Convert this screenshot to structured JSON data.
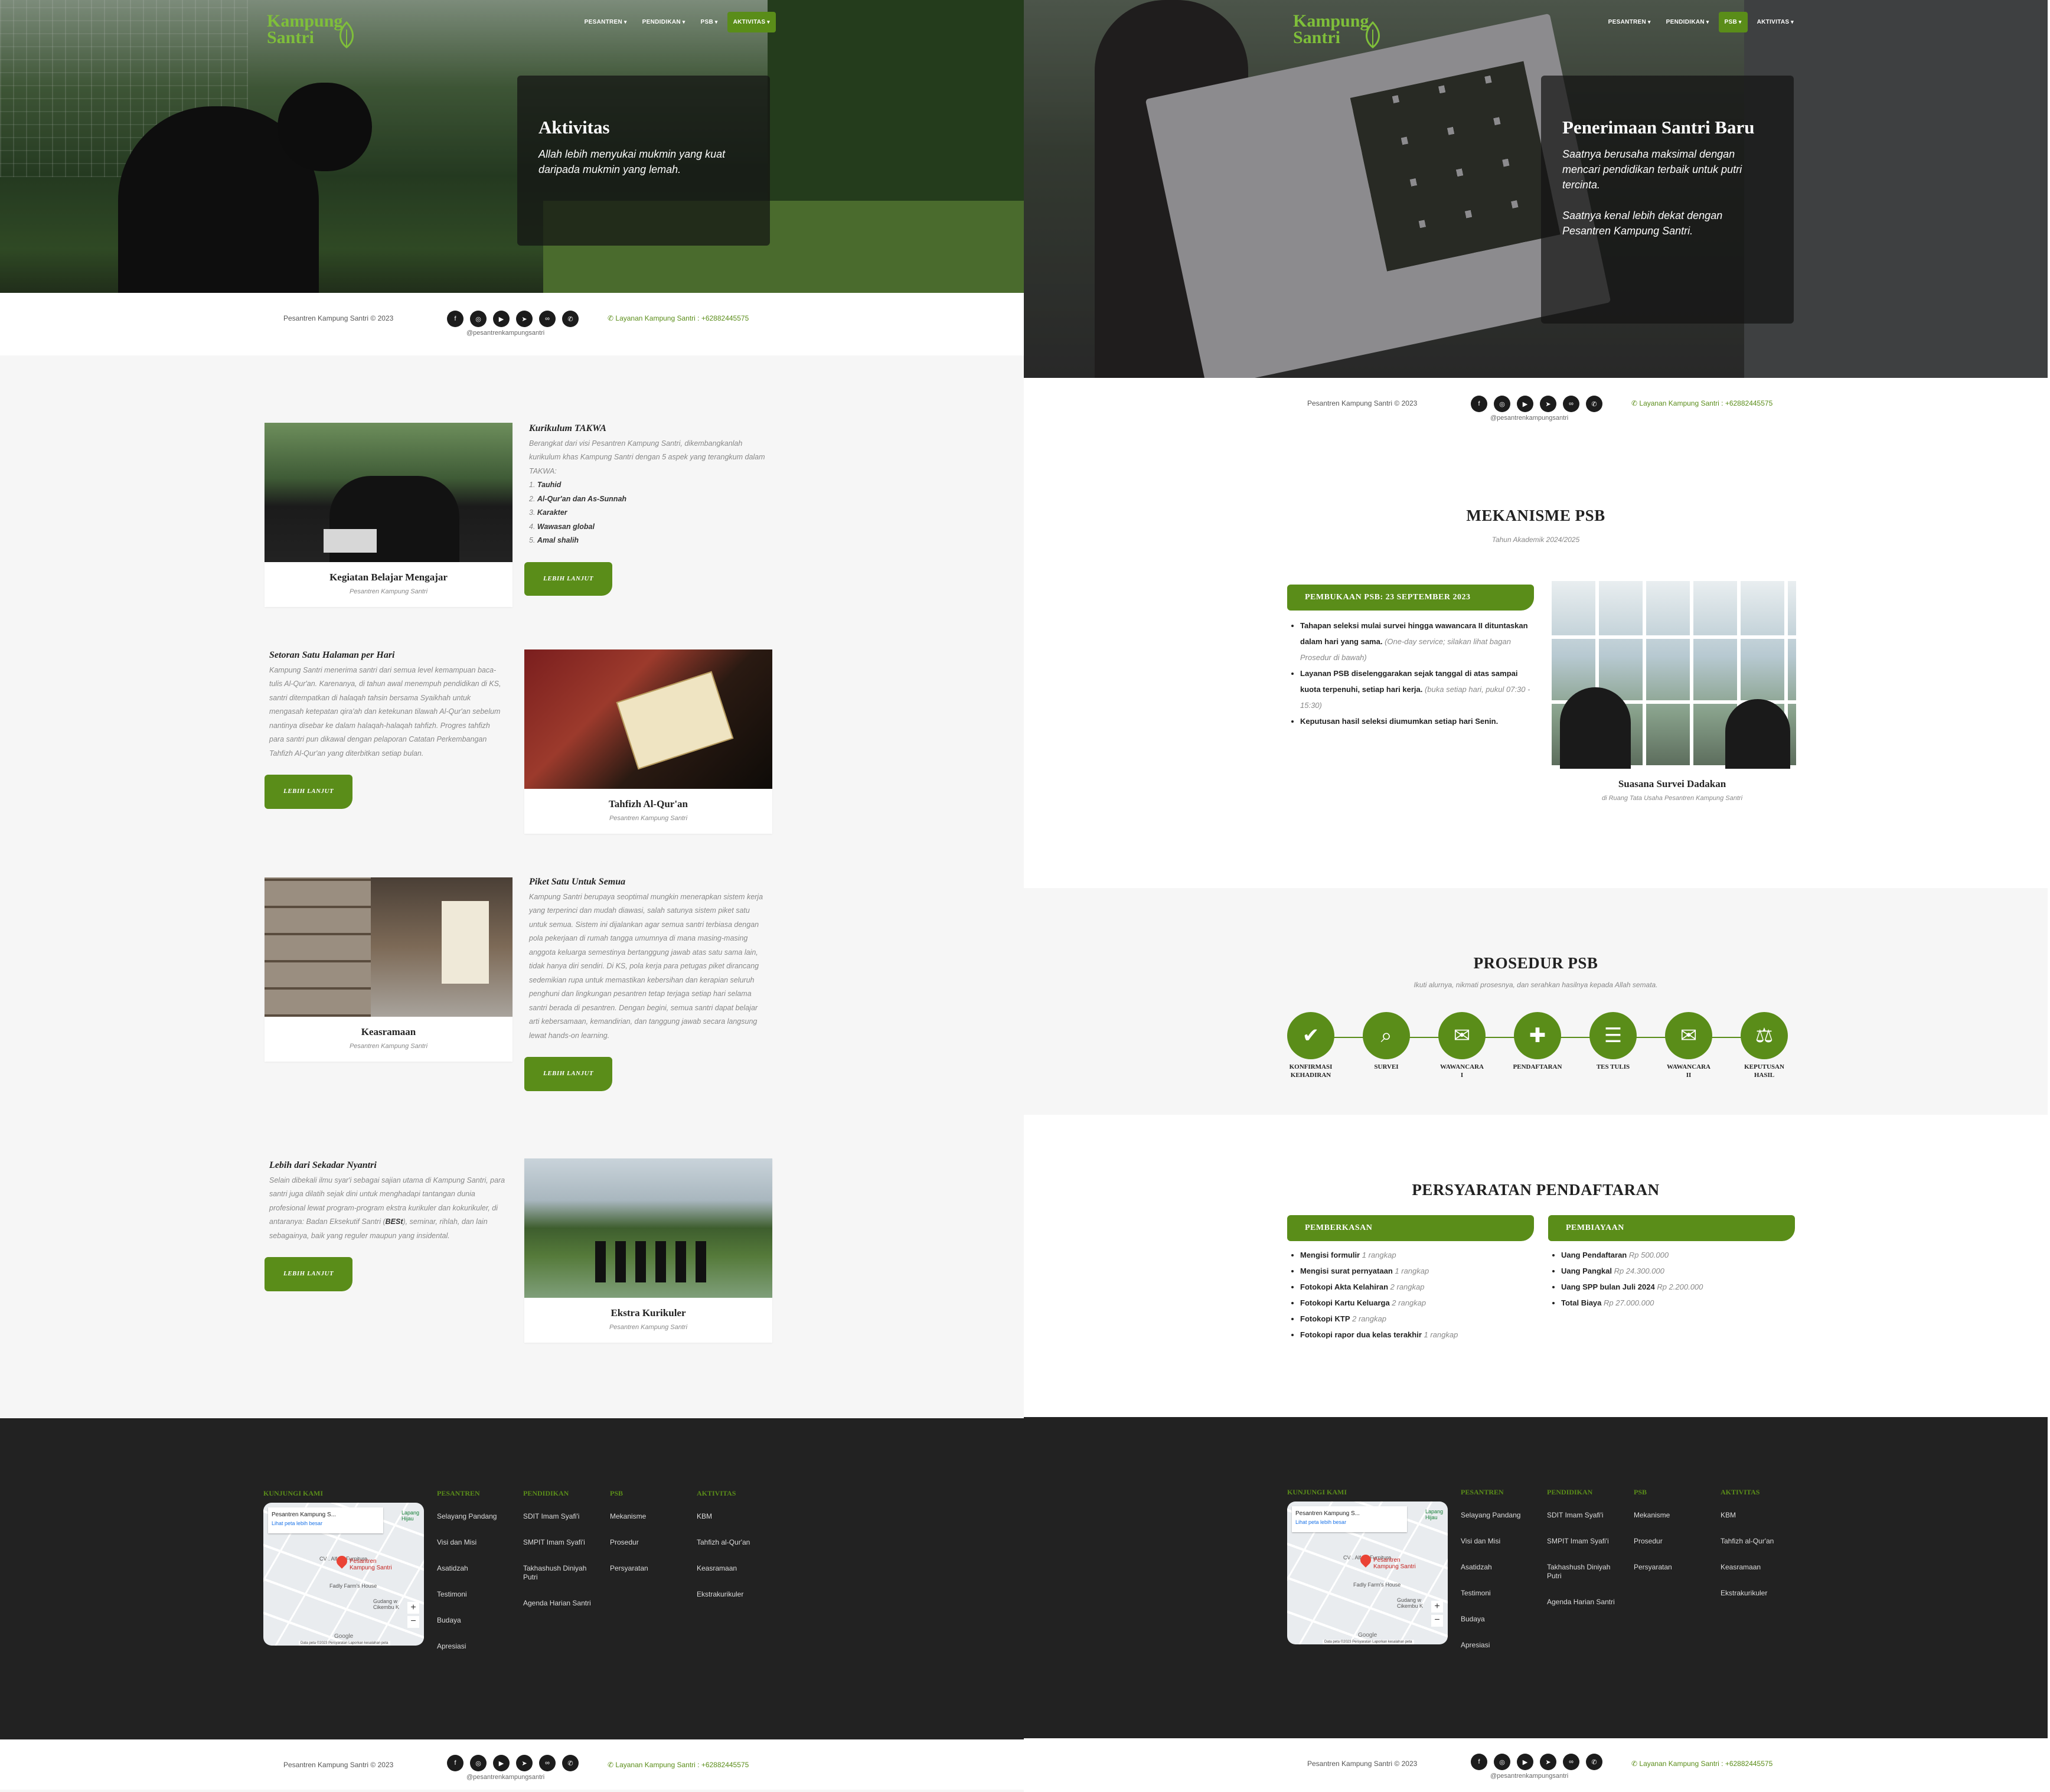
{
  "logo": {
    "line1": "Kampung",
    "line2": "Santri"
  },
  "nav_left": [
    {
      "label": "PESANTREN",
      "active": false
    },
    {
      "label": "PENDIDIKAN",
      "active": false
    },
    {
      "label": "PSB",
      "active": false
    },
    {
      "label": "AKTIVITAS",
      "active": true
    }
  ],
  "nav_right": [
    {
      "label": "PESANTREN",
      "active": false
    },
    {
      "label": "PENDIDIKAN",
      "active": false
    },
    {
      "label": "PSB",
      "active": true
    },
    {
      "label": "AKTIVITAS",
      "active": false
    }
  ],
  "hero_left": {
    "title": "Aktivitas",
    "text": "Allah lebih menyukai mukmin yang kuat daripada mukmin yang lemah."
  },
  "hero_right": {
    "title": "Penerimaan Santri Baru",
    "text1": "Saatnya berusaha maksimal dengan mencari pendidikan terbaik untuk putri tercinta.",
    "text2": "Saatnya kenal lebih dekat dengan Pesantren Kampung Santri."
  },
  "info": {
    "copyright": "Pesantren Kampung Santri © 2023",
    "handle": "@pesantrenkampungsantri",
    "phone": "Layanan Kampung Santri : +62882445575",
    "social_icons": [
      "facebook-icon",
      "instagram-icon",
      "youtube-icon",
      "telegram-icon",
      "link-icon",
      "whatsapp-icon"
    ]
  },
  "activities": [
    {
      "card_title": "Kegiatan Belajar Mengajar",
      "card_sub": "Pesantren Kampung Santri",
      "heading": "Kurikulum TAKWA",
      "body": "Berangkat dari visi Pesantren Kampung Santri, dikembangkanlah kurikulum khas Kampung Santri dengan 5 aspek yang terangkum dalam TAKWA:",
      "list": [
        "Tauhid",
        "Al-Qur'an dan As-Sunnah",
        "Karakter",
        "Wawasan global",
        "Amal shalih"
      ],
      "button": "LEBIH LANJUT"
    },
    {
      "card_title": "Tahfizh Al-Qur'an",
      "card_sub": "Pesantren Kampung Santri",
      "heading": "Setoran Satu Halaman per Hari",
      "body": "Kampung Santri menerima santri dari semua level kemampuan baca-tulis Al-Qur'an. Karenanya, di tahun awal menempuh pendidikan di KS, santri ditempatkan di halaqah tahsin bersama Syaikhah untuk mengasah ketepatan qira'ah dan ketekunan tilawah Al-Qur'an sebelum nantinya disebar ke dalam halaqah-halaqah tahfizh. Progres tahfizh para santri pun dikawal dengan pelaporan Catatan Perkembangan Tahfizh Al-Qur'an yang diterbitkan setiap bulan.",
      "button": "LEBIH LANJUT"
    },
    {
      "card_title": "Keasramaan",
      "card_sub": "Pesantren Kampung Santri",
      "heading": "Piket Satu Untuk Semua",
      "body": "Kampung Santri berupaya seoptimal mungkin menerapkan sistem kerja yang terperinci dan mudah diawasi, salah satunya sistem piket satu untuk semua. Sistem ini dijalankan agar semua santri terbiasa dengan pola pekerjaan di rumah tangga umumnya di mana masing-masing anggota keluarga semestinya bertanggung jawab atas satu sama lain, tidak hanya diri sendiri. Di KS, pola kerja para petugas piket dirancang sedemikian rupa untuk memastikan kebersihan dan kerapian seluruh penghuni dan lingkungan pesantren tetap terjaga setiap hari selama santri berada di pesantren. Dengan begini, semua santri dapat belajar arti kebersamaan, kemandirian, dan tanggung jawab secara langsung lewat hands-on learning.",
      "button": "LEBIH LANJUT"
    },
    {
      "card_title": "Ekstra Kurikuler",
      "card_sub": "Pesantren Kampung Santri",
      "heading": "Lebih dari Sekadar Nyantri",
      "body_a": "Selain dibekali ilmu syar'i sebagai sajian utama di Kampung Santri, para santri juga dilatih sejak dini untuk menghadapi tantangan dunia profesional lewat program-program ekstra kurikuler dan kokurikuler, di antaranya: Badan Eksekutif Santri (",
      "body_bold": "BESt",
      "body_b": "), seminar, rihlah, dan lain sebagainya, baik yang reguler maupun yang insidental.",
      "button": "LEBIH LANJUT"
    }
  ],
  "footer": {
    "visit_title": "KUNJUNGI KAMI",
    "map": {
      "place": "Pesantren Kampung S...",
      "link": "Lihat peta lebih besar",
      "pin": "Pesantren Kampung Santri",
      "label1": "CV . Alfath Furniture",
      "label2": "Lapang Hijau",
      "label3": "Fadly Farm's House",
      "label4": "Gudang w Cikembu K",
      "google": "Google",
      "credits": "Data peta ©2023   Persyaratan   Laporkan kesalahan peta"
    },
    "columns": [
      {
        "title": "PESANTREN",
        "links": [
          "Selayang Pandang",
          "Visi dan Misi",
          "Asatidzah",
          "Testimoni",
          "Budaya",
          "Apresiasi"
        ]
      },
      {
        "title": "PENDIDIKAN",
        "links": [
          "SDIT Imam Syafi'i",
          "SMPIT Imam Syafi'i",
          "Takhashush Diniyah Putri",
          "Agenda Harian Santri"
        ]
      },
      {
        "title": "PSB",
        "links": [
          "Mekanisme",
          "Prosedur",
          "Persyaratan"
        ]
      },
      {
        "title": "AKTIVITAS",
        "links": [
          "KBM",
          "Tahfizh al-Qur'an",
          "Keasramaan",
          "Ekstrakurikuler"
        ]
      }
    ]
  },
  "mekanisme": {
    "title": "MEKANISME PSB",
    "subtitle": "Tahun Akademik 2024/2025",
    "bar": "PEMBUKAAN PSB: 23 SEPTEMBER 2023",
    "items": [
      {
        "bold": "Tahapan seleksi mulai survei hingga wawancara II dituntaskan dalam hari yang sama.",
        "note": " (One-day service; silakan lihat bagan Prosedur di bawah)"
      },
      {
        "bold": "Layanan PSB diselenggarakan sejak tanggal di atas sampai kuota terpenuhi, setiap hari kerja.",
        "note": " (buka setiap hari, pukul 07:30 - 15:30)"
      },
      {
        "bold": "Keputusan hasil seleksi diumumkan setiap hari Senin.",
        "note": ""
      }
    ],
    "photo_title": "Suasana Survei Dadakan",
    "photo_sub": "di Ruang Tata Usaha Pesantren Kampung Santri"
  },
  "prosedur": {
    "title": "PROSEDUR PSB",
    "subtitle": "Ikuti alurnya, nikmati prosesnya, dan serahkan hasilnya kepada Allah semata.",
    "steps": [
      {
        "l1": "KONFIRMASI",
        "l2": "KEHADIRAN",
        "icon": "user-check-icon",
        "glyph": "✔"
      },
      {
        "l1": "SURVEI",
        "l2": "",
        "icon": "map-pin-search-icon",
        "glyph": "⌕"
      },
      {
        "l1": "WAWANCARA",
        "l2": "I",
        "icon": "chat-bubble-icon",
        "glyph": "✉"
      },
      {
        "l1": "PENDAFTARAN",
        "l2": "",
        "icon": "gift-icon",
        "glyph": "✚"
      },
      {
        "l1": "TES TULIS",
        "l2": "",
        "icon": "list-icon",
        "glyph": "☰"
      },
      {
        "l1": "WAWANCARA",
        "l2": "II",
        "icon": "chat-bubbles-icon",
        "glyph": "✉"
      },
      {
        "l1": "KEPUTUSAN",
        "l2": "HASIL",
        "icon": "gavel-icon",
        "glyph": "⚖"
      }
    ]
  },
  "persyaratan": {
    "title": "PERSYARATAN PENDAFTARAN",
    "left_bar": "PEMBERKASAN",
    "right_bar": "PEMBIAYAAN",
    "left": [
      {
        "b": "Mengisi formulir",
        "n": " 1 rangkap"
      },
      {
        "b": "Mengisi surat pernyataan",
        "n": " 1 rangkap"
      },
      {
        "b": "Fotokopi Akta Kelahiran",
        "n": " 2 rangkap"
      },
      {
        "b": "Fotokopi Kartu Keluarga",
        "n": " 2 rangkap"
      },
      {
        "b": "Fotokopi KTP",
        "n": " 2 rangkap"
      },
      {
        "b": "Fotokopi rapor dua kelas terakhir",
        "n": " 1 rangkap"
      }
    ],
    "right": [
      {
        "b": "Uang Pendaftaran",
        "n": " Rp 500.000"
      },
      {
        "b": "Uang Pangkal",
        "n": " Rp 24.300.000"
      },
      {
        "b": "Uang SPP bulan Juli 2024",
        "n": " Rp 2.200.000"
      },
      {
        "b": "Total Biaya",
        "n": " Rp 27.000.000"
      }
    ]
  }
}
